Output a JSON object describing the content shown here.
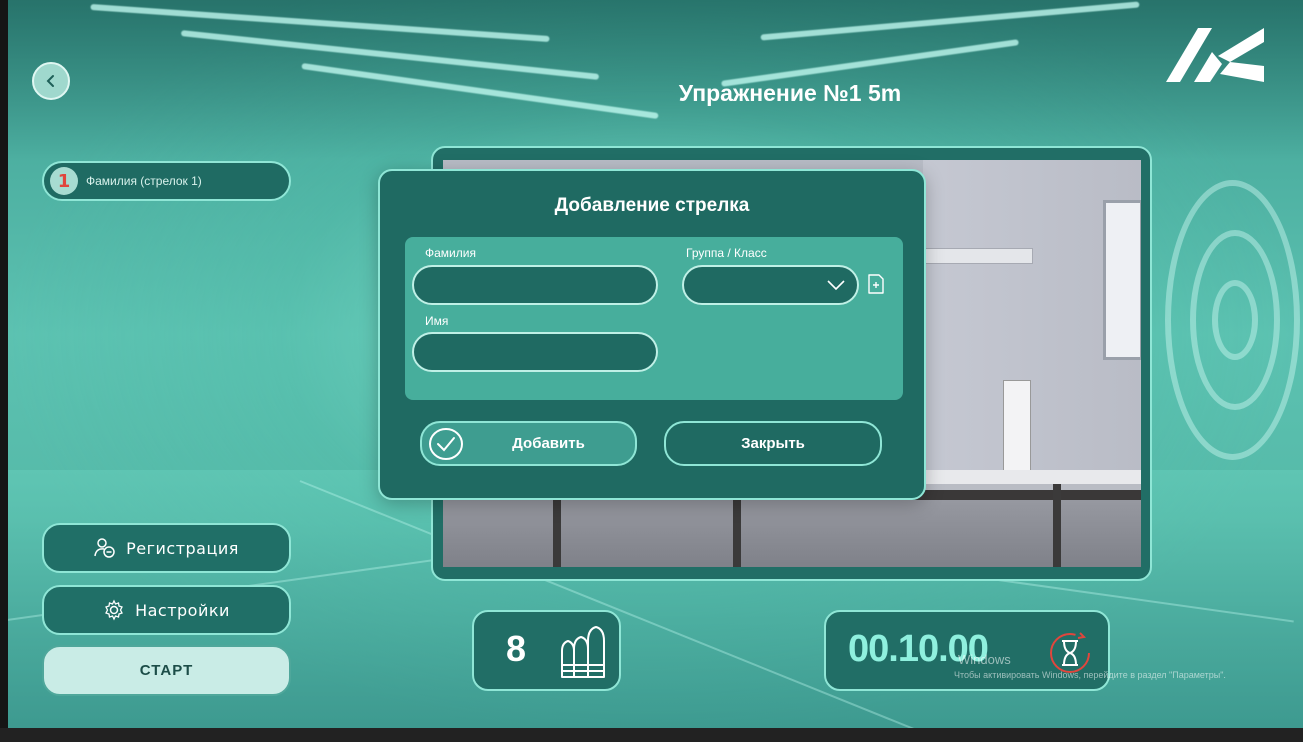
{
  "header": {
    "title": "Упражнение №1 5m"
  },
  "shooter_list": [
    {
      "number": "1",
      "name": "Фамилия (стрелок 1)"
    }
  ],
  "menu": {
    "registration_label": "Регистрация",
    "settings_label": "Настройки",
    "start_label": "СТАРТ"
  },
  "dialog": {
    "title": "Добавление стрелка",
    "surname_label": "Фамилия",
    "surname_value": "",
    "group_label": "Группа / Класс",
    "group_value": "",
    "name_label": "Имя",
    "name_value": "",
    "add_label": "Добавить",
    "close_label": "Закрыть"
  },
  "stats": {
    "ammo_count": "8",
    "timer": "00.10.00"
  },
  "watermark": {
    "line1": "Windows",
    "line2": "Чтобы активировать Windows, перейдите в раздел \"Параметры\"."
  },
  "colors": {
    "panel": "#1f6a62",
    "accent_border": "#8fe6d6",
    "form_area": "#47ae9c",
    "timer_text": "#8ff0de",
    "warning_red": "#e0463d"
  },
  "icons": {
    "back": "chevron-left-icon",
    "registration": "user-add-icon",
    "settings": "gear-icon",
    "ammo": "bullets-icon",
    "timer": "hourglass-icon",
    "add_group": "add-document-icon",
    "confirm": "check-circle-icon",
    "dropdown": "chevron-down-icon"
  }
}
